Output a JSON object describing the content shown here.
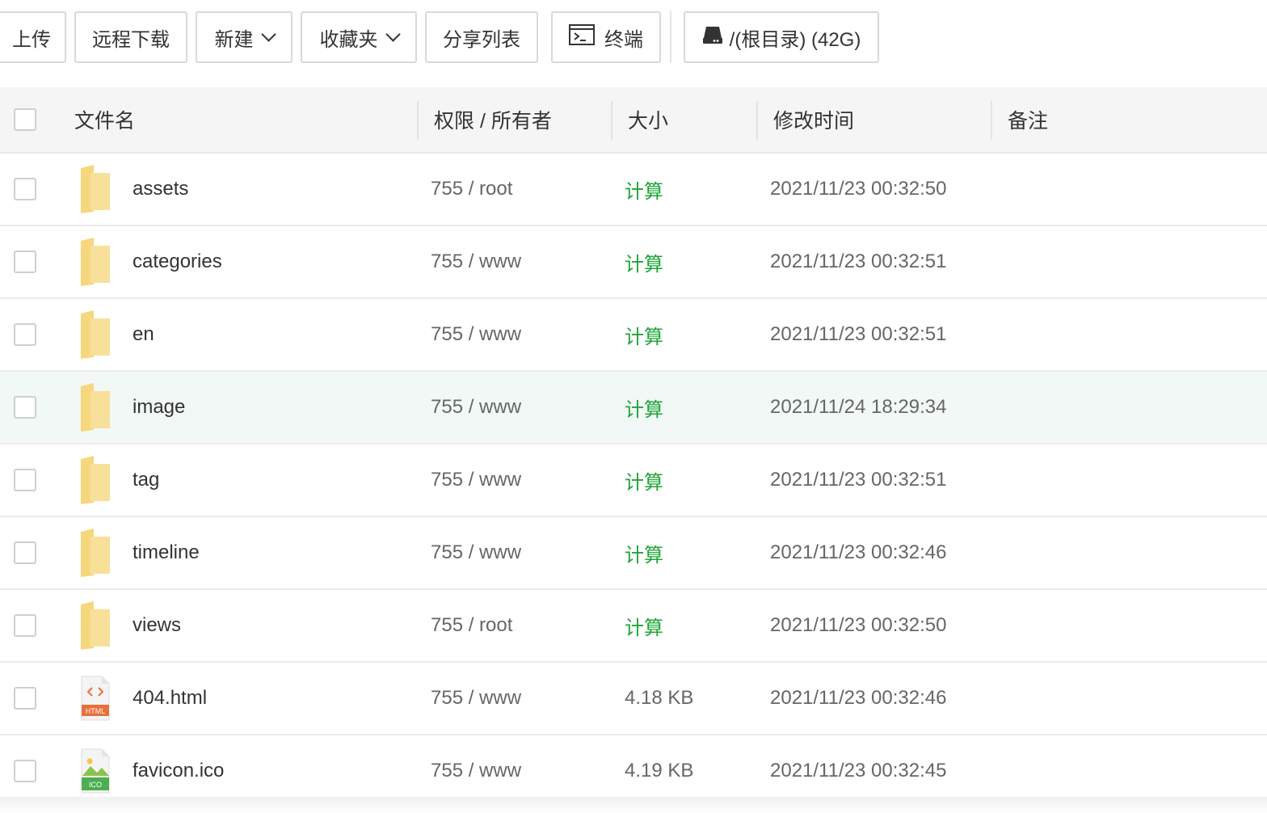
{
  "toolbar": {
    "upload": "上传",
    "remote_download": "远程下载",
    "new": "新建",
    "favorites": "收藏夹",
    "share_list": "分享列表",
    "terminal": "终端",
    "disk": "/(根目录) (42G)"
  },
  "table": {
    "headers": {
      "name": "文件名",
      "perm_owner": "权限 / 所有者",
      "size": "大小",
      "mtime": "修改时间",
      "remark": "备注"
    },
    "rows": [
      {
        "name": "assets",
        "type": "folder",
        "perm": "755 / root",
        "size": "计算",
        "mtime": "2021/11/23 00:32:50",
        "remark": ""
      },
      {
        "name": "categories",
        "type": "folder",
        "perm": "755 / www",
        "size": "计算",
        "mtime": "2021/11/23 00:32:51",
        "remark": ""
      },
      {
        "name": "en",
        "type": "folder",
        "perm": "755 / www",
        "size": "计算",
        "mtime": "2021/11/23 00:32:51",
        "remark": ""
      },
      {
        "name": "image",
        "type": "folder",
        "perm": "755 / www",
        "size": "计算",
        "mtime": "2021/11/24 18:29:34",
        "remark": "",
        "highlighted": true
      },
      {
        "name": "tag",
        "type": "folder",
        "perm": "755 / www",
        "size": "计算",
        "mtime": "2021/11/23 00:32:51",
        "remark": ""
      },
      {
        "name": "timeline",
        "type": "folder",
        "perm": "755 / www",
        "size": "计算",
        "mtime": "2021/11/23 00:32:46",
        "remark": ""
      },
      {
        "name": "views",
        "type": "folder",
        "perm": "755 / root",
        "size": "计算",
        "mtime": "2021/11/23 00:32:50",
        "remark": ""
      },
      {
        "name": "404.html",
        "type": "html",
        "badge": "HTML",
        "perm": "755 / www",
        "size": "4.18 KB",
        "mtime": "2021/11/23 00:32:46",
        "remark": ""
      },
      {
        "name": "favicon.ico",
        "type": "image",
        "badge": "ICO",
        "perm": "755 / www",
        "size": "4.19 KB",
        "mtime": "2021/11/23 00:32:45",
        "remark": ""
      }
    ]
  },
  "colors": {
    "accent_green": "#20a53a",
    "folder_yellow": "#f8d775",
    "html_badge": "#e8703a",
    "ico_badge": "#4caf50",
    "highlight_row": "#f1f8f5"
  },
  "icons": {
    "terminal": "terminal-icon",
    "disk": "hard-drive-icon",
    "dropdown": "chevron-down-icon",
    "folder": "folder-icon",
    "html": "html-file-icon",
    "image": "image-file-icon"
  }
}
